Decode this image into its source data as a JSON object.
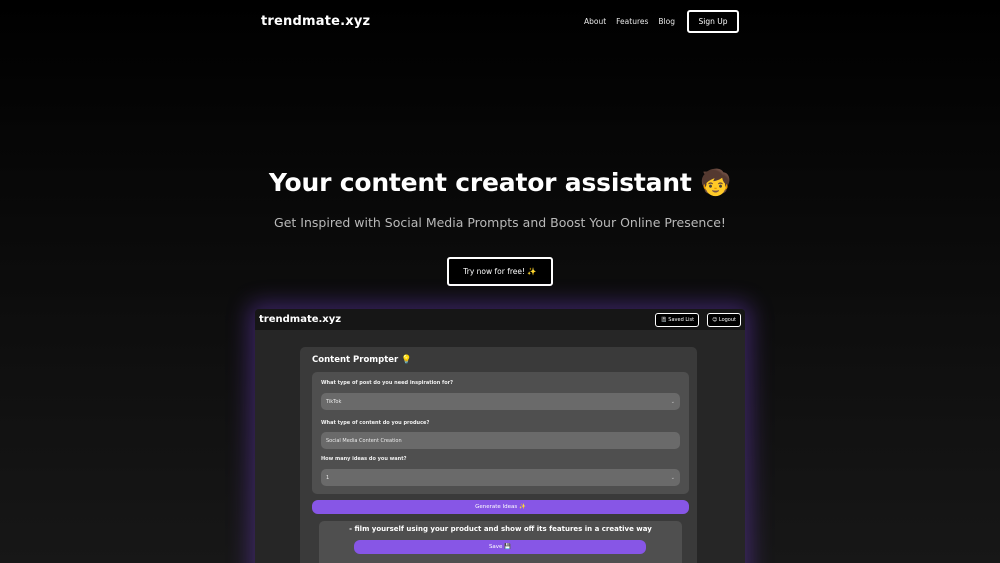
{
  "nav": {
    "brand": "trendmate.xyz",
    "links": [
      "About",
      "Features",
      "Blog"
    ],
    "signup_label": "Sign Up"
  },
  "hero": {
    "title": "Your content creator assistant 🧒",
    "subtitle": "Get Inspired with Social Media Prompts and Boost Your Online Presence!",
    "cta_label": "Try now for free! ✨"
  },
  "preview": {
    "brand": "trendmate.xyz",
    "saved_list_label": "📓 Saved List",
    "logout_label": "😊 Logout",
    "card_title": "Content Prompter 💡",
    "questions": [
      {
        "label": "What type of post do you need inspiration for?",
        "value": "TikTok",
        "chevron": "⌄"
      },
      {
        "label": "What type of content do you produce?",
        "value": "Social Media Content Creation",
        "chevron": ""
      },
      {
        "label": "How many ideas do you want?",
        "value": "1",
        "chevron": "⌄"
      }
    ],
    "generate_label": "Generate Ideas ✨",
    "idea_text": "- film yourself using your product and show off its features in a creative way",
    "save_label": "Save 💾"
  },
  "colors": {
    "accent": "#8756e6",
    "glow": "#7e48e6",
    "background": "#000000"
  }
}
